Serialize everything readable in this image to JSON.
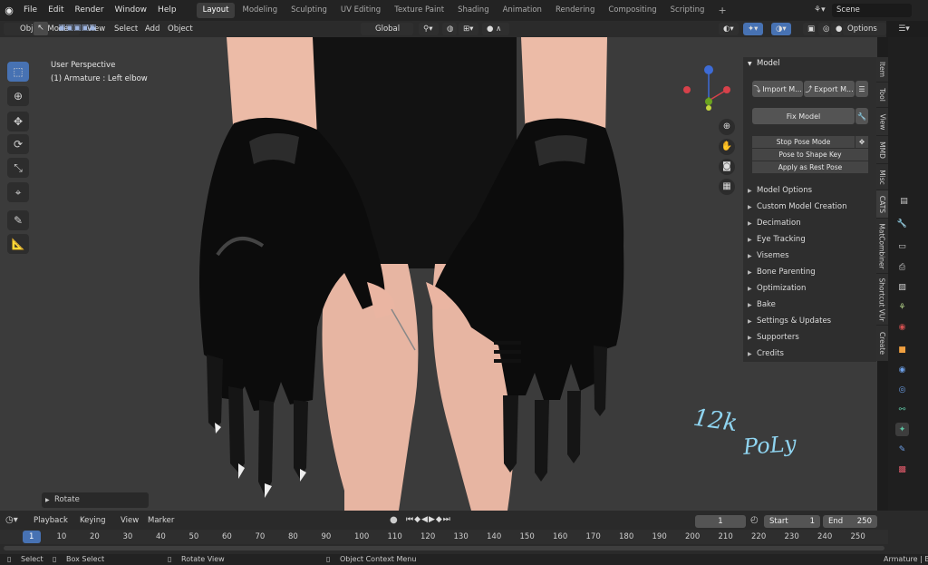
{
  "menu": {
    "items": [
      "File",
      "Edit",
      "Render",
      "Window",
      "Help"
    ],
    "workspaces": [
      "Layout",
      "Modeling",
      "Sculpting",
      "UV Editing",
      "Texture Paint",
      "Shading",
      "Animation",
      "Rendering",
      "Compositing",
      "Scripting"
    ],
    "active_workspace": "Layout",
    "add_tab": "+",
    "scene_name": "Scene"
  },
  "header": {
    "mode": "Object Mode",
    "view": "View",
    "select": "Select",
    "add": "Add",
    "object": "Object",
    "orientation": "Global",
    "options": "Options"
  },
  "viewport": {
    "perspective": "User Perspective",
    "active_object": "(1) Armature : Left elbow",
    "last_op": "Rotate",
    "annotation_line1": "12k",
    "annotation_line2": "PoLy",
    "colors": {
      "background": "#3b3b3b",
      "glove": "#0c0c0c",
      "skin": "#eab9a6",
      "dress": "#121212"
    }
  },
  "npanel": {
    "title": "Model",
    "import_label": "Import M...",
    "export_label": "Export M...",
    "fix_model": "Fix Model",
    "stop_pose": "Stop Pose Mode",
    "pose_to_shape": "Pose to Shape Key",
    "apply_rest": "Apply as Rest Pose",
    "sections": [
      "Model Options",
      "Custom Model Creation",
      "Decimation",
      "Eye Tracking",
      "Visemes",
      "Bone Parenting",
      "Optimization",
      "Bake",
      "Settings & Updates",
      "Supporters",
      "Credits"
    ]
  },
  "vtabs": [
    "Item",
    "Tool",
    "View",
    "MMD",
    "Misc",
    "CATS",
    "MatCombiner",
    "Shortcut VUr",
    "Create"
  ],
  "timeline": {
    "playback": "Playback",
    "keying": "Keying",
    "view": "View",
    "marker": "Marker",
    "current_frame": "1",
    "start_label": "Start",
    "start": "1",
    "end_label": "End",
    "end": "250",
    "ticks": [
      "1",
      "10",
      "20",
      "30",
      "40",
      "50",
      "60",
      "70",
      "80",
      "90",
      "100",
      "110",
      "120",
      "130",
      "140",
      "150",
      "160",
      "170",
      "180",
      "190",
      "200",
      "210",
      "220",
      "230",
      "240",
      "250"
    ]
  },
  "status": {
    "select": "Select",
    "box_select": "Box Select",
    "rotate_view": "Rotate View",
    "context_menu": "Object Context Menu",
    "right_info": "Armature | B"
  }
}
